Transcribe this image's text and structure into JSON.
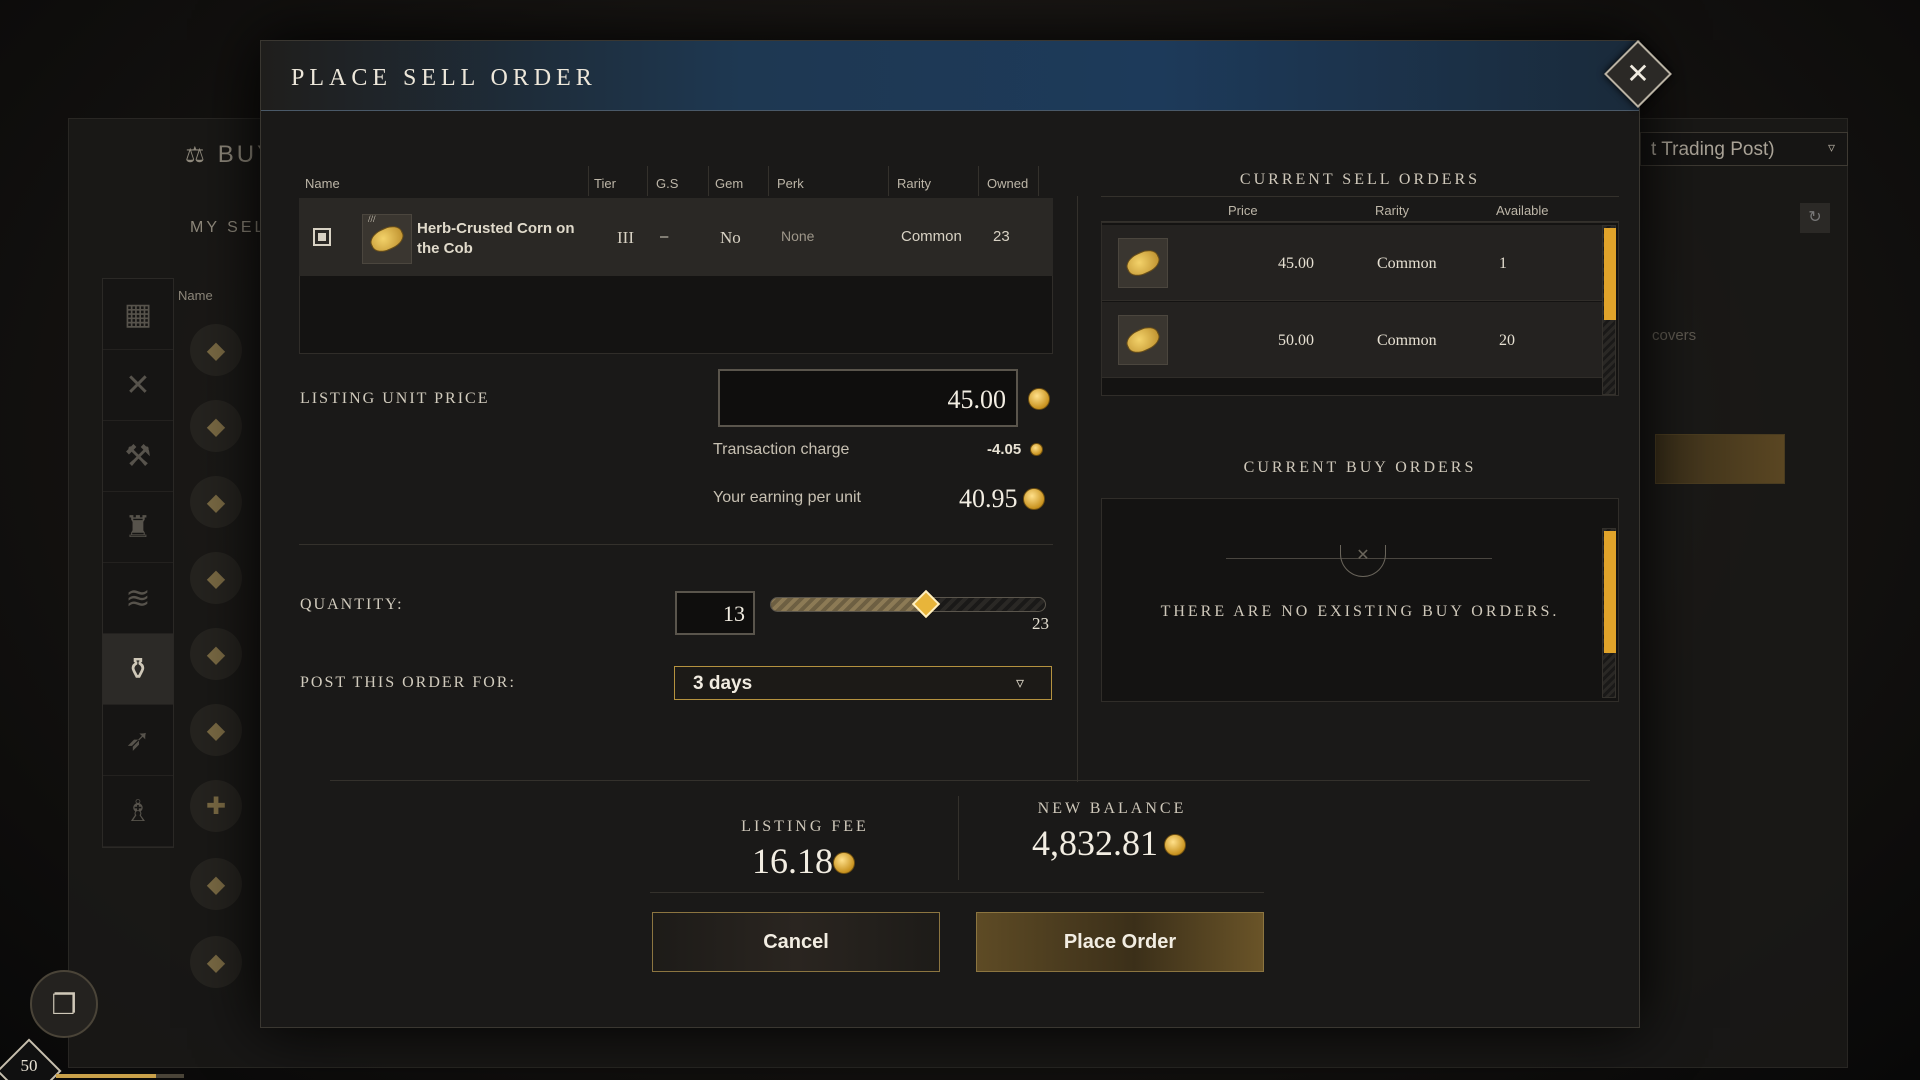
{
  "background": {
    "buy_tab": "BUY",
    "my_sell_orders": "MY SEL",
    "name_header": "Name",
    "trading_post_dropdown": "t Trading Post)",
    "covers_text": "covers",
    "level": "50",
    "xp_fraction": 0.78
  },
  "modal": {
    "title": "PLACE SELL ORDER",
    "close_icon": "close-icon"
  },
  "item_table": {
    "headers": {
      "name": "Name",
      "tier": "Tier",
      "gs": "G.S",
      "gem": "Gem",
      "perk": "Perk",
      "rarity": "Rarity",
      "owned": "Owned"
    },
    "row": {
      "name_line1": "Herb-Crusted Corn on",
      "name_line2": "the Cob",
      "tier": "III",
      "gs": "–",
      "gem": "No",
      "perk": "None",
      "rarity": "Common",
      "owned": "23",
      "icon": "corn-icon"
    }
  },
  "pricing": {
    "listing_unit_price_label": "LISTING UNIT PRICE",
    "listing_unit_price": "45.00",
    "transaction_charge_label": "Transaction charge",
    "transaction_charge": "-4.05",
    "earning_label": "Your earning per unit",
    "earning": "40.95"
  },
  "quantity": {
    "label": "QUANTITY:",
    "value": "13",
    "max": "23",
    "fraction": 0.5652
  },
  "duration": {
    "label": "POST THIS ORDER FOR:",
    "selected": "3 days"
  },
  "current_sell_orders": {
    "title": "CURRENT SELL ORDERS",
    "headers": {
      "price": "Price",
      "rarity": "Rarity",
      "available": "Available"
    },
    "rows": [
      {
        "price": "45.00",
        "rarity": "Common",
        "available": "1"
      },
      {
        "price": "50.00",
        "rarity": "Common",
        "available": "20"
      }
    ]
  },
  "current_buy_orders": {
    "title": "CURRENT BUY ORDERS",
    "empty_message": "THERE ARE NO EXISTING BUY ORDERS."
  },
  "footer": {
    "listing_fee_label": "LISTING FEE",
    "listing_fee": "16.18",
    "new_balance_label": "NEW BALANCE",
    "new_balance": "4,832.81",
    "cancel_label": "Cancel",
    "place_order_label": "Place Order"
  },
  "colors": {
    "accent_gold": "#e0a32a",
    "header_blue": "#1d3a5a"
  }
}
